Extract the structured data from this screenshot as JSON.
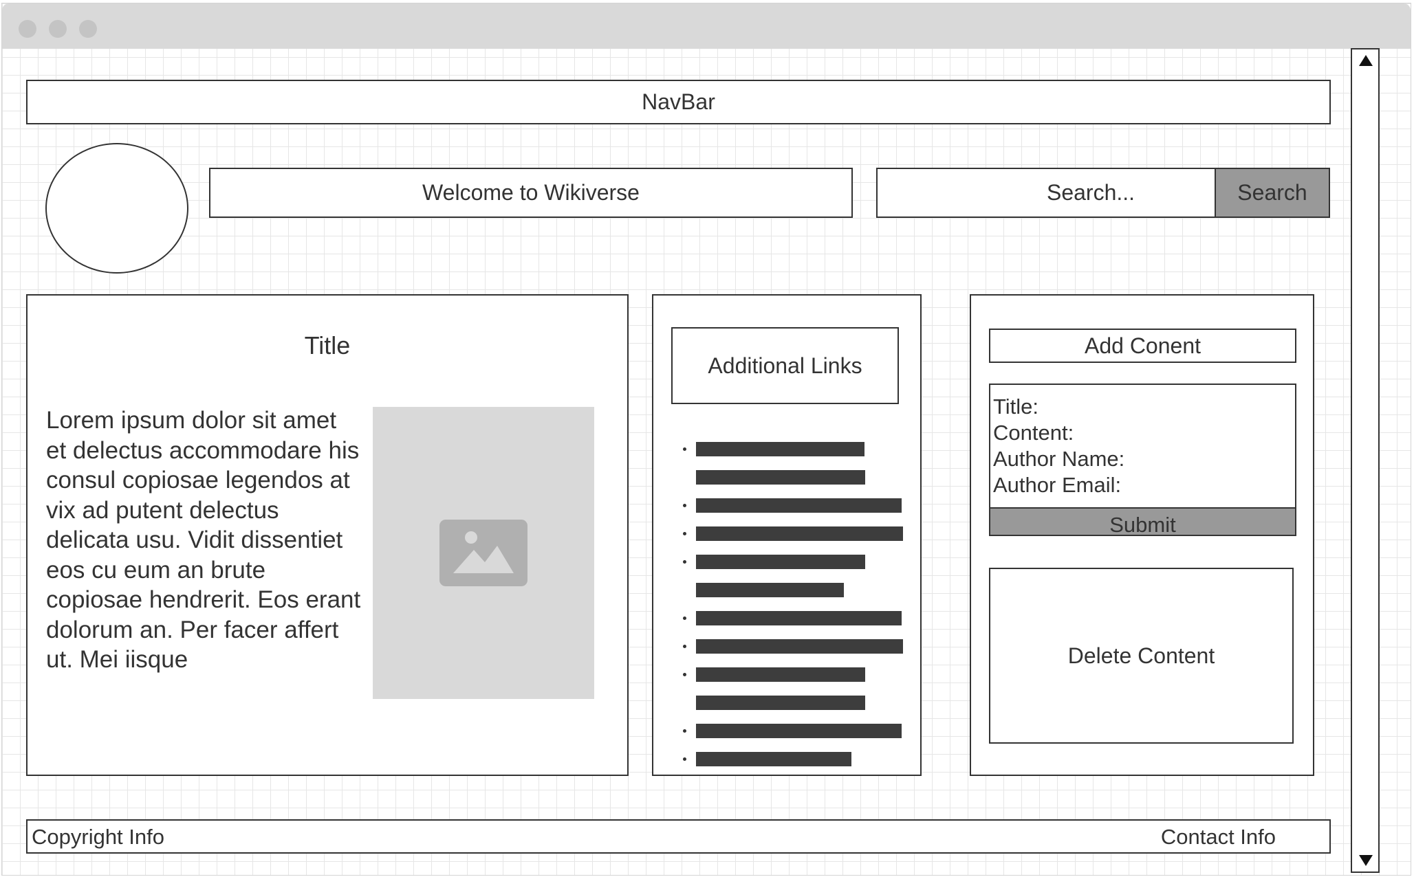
{
  "navbar": {
    "label": "NavBar"
  },
  "header": {
    "welcome": "Welcome to Wikiverse",
    "search_placeholder": "Search...",
    "search_button": "Search"
  },
  "article": {
    "title": "Title",
    "body": "Lorem ipsum dolor sit amet et delectus accommodare his consul copiosae legendos at vix ad putent delectus delicata usu. Vidit dissentiet eos cu eum an brute copiosae hendrerit. Eos erant dolorum an. Per facer affert ut. Mei iisque",
    "image_icon": "image-placeholder-icon"
  },
  "links": {
    "heading": "Additional Links",
    "items": [
      {
        "lines": 2
      },
      {
        "lines": 1
      },
      {
        "lines": 1
      },
      {
        "lines": 2
      },
      {
        "lines": 1
      },
      {
        "lines": 1
      },
      {
        "lines": 2
      },
      {
        "lines": 1
      },
      {
        "lines": 1
      }
    ]
  },
  "add_content": {
    "heading": "Add Conent",
    "fields": [
      "Title:",
      "Content:",
      "Author Name:",
      "Author Email:"
    ],
    "submit": "Submit"
  },
  "delete_content": {
    "label": "Delete Content"
  },
  "footer": {
    "copyright": "Copyright Info",
    "contact": "Contact Info"
  },
  "colors": {
    "border": "#333333",
    "button_fill": "#999999",
    "placeholder_fill": "#d9d9d9",
    "bar_fill": "#3d3d3d"
  }
}
